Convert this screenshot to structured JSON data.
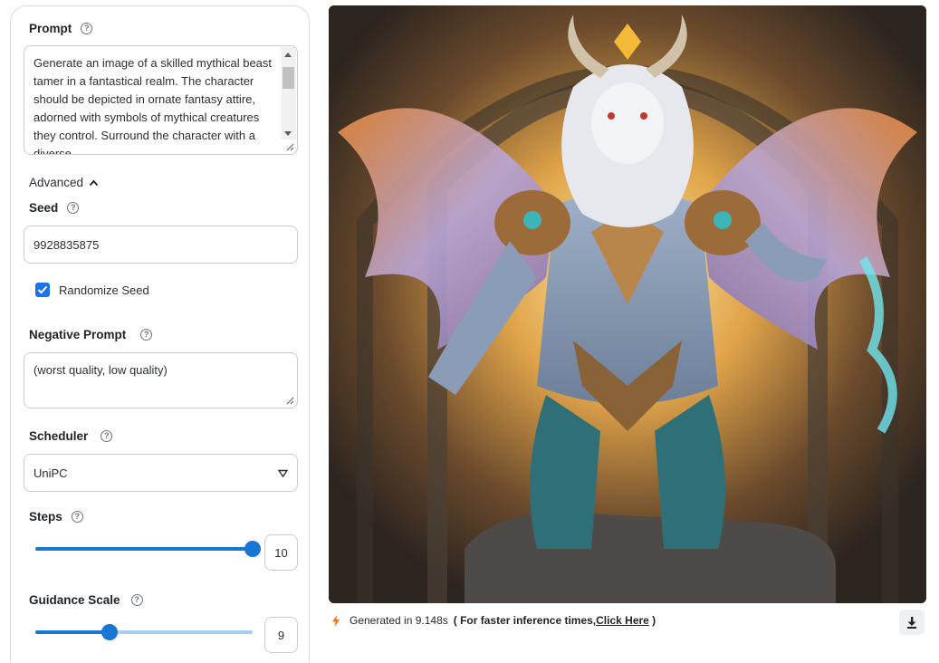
{
  "prompt": {
    "label": "Prompt",
    "text": "Generate an image of a skilled mythical beast tamer in a fantastical realm. The character should be depicted in ornate fantasy attire, adorned with symbols of mythical creatures they control. Surround the character with a diverse"
  },
  "advanced": {
    "label": "Advanced"
  },
  "seed": {
    "label": "Seed",
    "value": "9928835875"
  },
  "randomize": {
    "label": "Randomize Seed",
    "checked": true
  },
  "negative_prompt": {
    "label": "Negative Prompt",
    "value": "(worst quality, low quality)"
  },
  "scheduler": {
    "label": "Scheduler",
    "value": "UniPC"
  },
  "steps": {
    "label": "Steps",
    "value": "10",
    "fraction": 1.0
  },
  "guidance": {
    "label": "Guidance Scale",
    "value": "9",
    "fraction": 0.34
  },
  "status": {
    "generated": "Generated in 9.148s",
    "faster_prefix": "( For faster inference times, ",
    "link": "Click Here",
    "suffix": " )"
  },
  "colors": {
    "accent": "#1976d2",
    "track_inactive": "#a8cdf2",
    "bolt": "#f97316"
  },
  "icons": [
    "help-icon",
    "chevron-up-icon",
    "check-icon",
    "dropdown-triangle-icon",
    "bolt-icon",
    "download-icon"
  ]
}
